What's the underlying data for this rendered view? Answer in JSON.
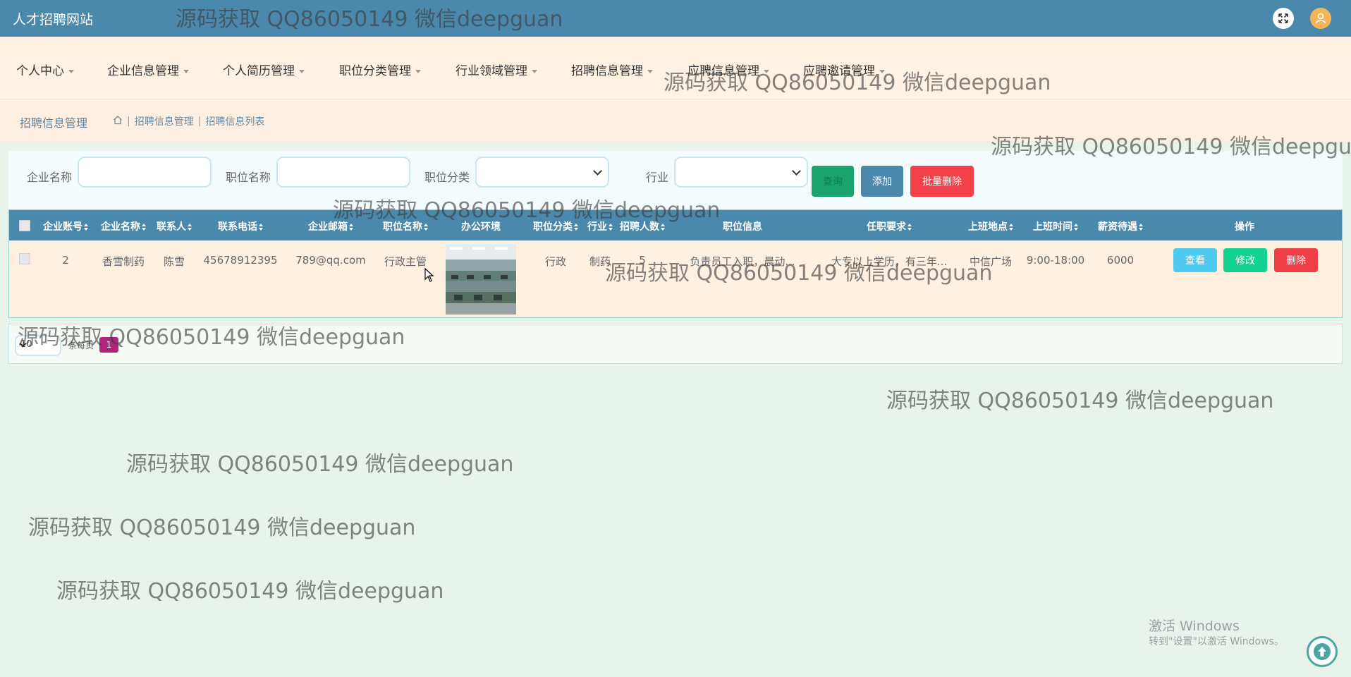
{
  "header": {
    "site_title": "人才招聘网站"
  },
  "nav": {
    "items": [
      "个人中心",
      "企业信息管理",
      "个人简历管理",
      "职位分类管理",
      "行业领域管理",
      "招聘信息管理",
      "应聘信息管理",
      "应聘邀请管理"
    ]
  },
  "breadcrumb": {
    "title": "招聘信息管理",
    "items": [
      "招聘信息管理",
      "招聘信息列表"
    ]
  },
  "search": {
    "company_label": "企业名称",
    "position_label": "职位名称",
    "category_label": "职位分类",
    "industry_label": "行业",
    "query_button": "查询",
    "add_button": "添加",
    "batch_delete_button": "批量删除"
  },
  "table": {
    "headers": [
      "企业账号",
      "企业名称",
      "联系人",
      "联系电话",
      "企业邮箱",
      "职位名称",
      "办公环境",
      "职位分类",
      "行业",
      "招聘人数",
      "职位信息",
      "任职要求",
      "上班地点",
      "上班时间",
      "薪资待遇",
      "操作"
    ],
    "row": {
      "account": "2",
      "company": "香雪制药",
      "contact": "陈雪",
      "phone": "45678912395",
      "email": "789@qq.com",
      "position": "行政主管",
      "category": "行政",
      "industry": "制药",
      "headcount": "5",
      "position_info": "负责员工入职，晨动...",
      "requirements": "大专以上学历，有三年...",
      "location": "中信广场",
      "work_time": "9:00-18:00",
      "salary": "6000"
    },
    "actions": {
      "view": "查看",
      "edit": "修改",
      "delete": "删除"
    }
  },
  "pager": {
    "page_size": "10",
    "per_page_label": "条每页",
    "current_page": "1"
  },
  "watermark_text": "源码获取 QQ86050149 微信deepguan",
  "windows": {
    "activate_title": "激活 Windows",
    "activate_sub": "转到\"设置\"以激活 Windows。"
  },
  "colors": {
    "header": "#4a89ab",
    "nav_bg": "#fff2e2",
    "query": "#1aa36e",
    "add": "#4a89ab",
    "batch_delete": "#f2414a",
    "view": "#4fcaf0",
    "edit": "#13d191",
    "delete": "#ef3f45",
    "page_active": "#b0247d"
  }
}
